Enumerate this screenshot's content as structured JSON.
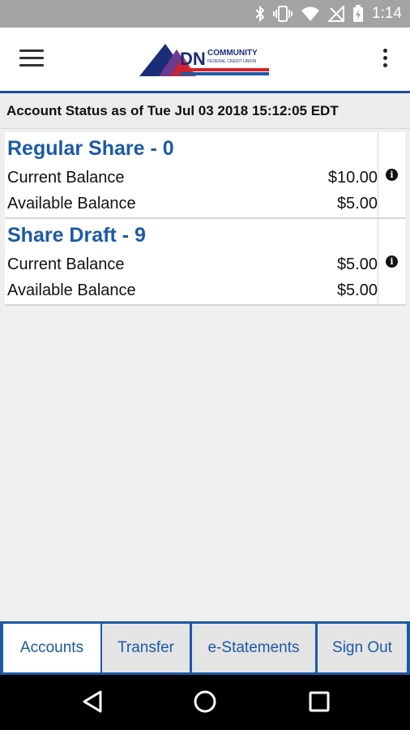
{
  "status_bar": {
    "time": "1:14",
    "icons": [
      "bluetooth-icon",
      "vibrate-icon",
      "wifi-icon",
      "no-signal-icon",
      "battery-charging-icon"
    ]
  },
  "header": {
    "logo_main": "DN",
    "logo_top": "COMMUNITY",
    "logo_sub": "FEDERAL CREDIT UNION",
    "brand_colors": {
      "blue": "#1c5aa6",
      "red": "#d71f28",
      "navy": "#1a2e78",
      "purple": "#6b3a8f"
    }
  },
  "status_line": "Account Status as of Tue Jul 03 2018 15:12:05 EDT",
  "accounts": [
    {
      "name": "Regular Share - 0",
      "current_label": "Current Balance",
      "current_value": "$10.00",
      "available_label": "Available Balance",
      "available_value": "$5.00"
    },
    {
      "name": "Share Draft - 9",
      "current_label": "Current Balance",
      "current_value": "$5.00",
      "available_label": "Available Balance",
      "available_value": "$5.00"
    }
  ],
  "bottom_nav": {
    "tabs": [
      {
        "label": "Accounts",
        "active": true
      },
      {
        "label": "Transfer",
        "active": false
      },
      {
        "label": "e-Statements",
        "active": false
      },
      {
        "label": "Sign Out",
        "active": false
      }
    ]
  },
  "system_nav": [
    "back-icon",
    "home-icon",
    "recents-icon"
  ]
}
